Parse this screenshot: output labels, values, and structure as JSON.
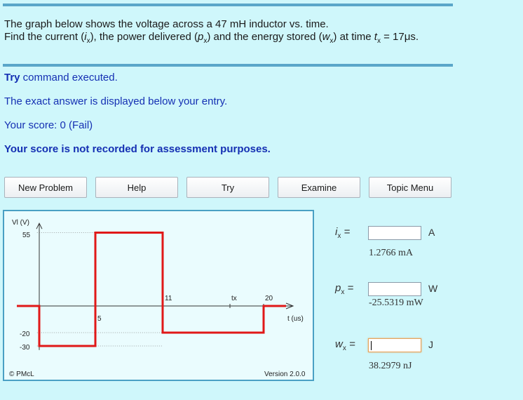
{
  "question": {
    "line1": "The graph below shows the voltage across a 47 mH inductor vs. time.",
    "line2_parts": [
      "Find the current (",
      "i",
      "x",
      "), the power delivered (",
      "p",
      "x",
      ") and the energy stored (",
      "w",
      "x",
      ") at time ",
      "t",
      "x",
      " = 17μs."
    ]
  },
  "messages": {
    "try_bold": "Try",
    "try_rest": " command executed.",
    "exact": "The exact answer is displayed below your entry.",
    "score": "Your score: 0 (Fail)",
    "not_recorded": "Your score is not recorded for assessment purposes."
  },
  "buttons": [
    "New Problem",
    "Help",
    "Try",
    "Examine",
    "Topic Menu"
  ],
  "graph": {
    "y_axis_label": "Vl (V)",
    "x_axis_label": "t (us)",
    "y_ticks": [
      "55",
      "-20",
      "-30"
    ],
    "x_ticks": [
      "5",
      "11",
      "tx",
      "20"
    ],
    "copyright": "© PMcL",
    "version": "Version 2.0.0"
  },
  "chart_data": {
    "type": "line",
    "title": "",
    "xlabel": "t (us)",
    "ylabel": "Vl (V)",
    "x": [
      -2,
      0,
      0,
      5,
      5,
      11,
      11,
      20,
      20,
      22
    ],
    "y": [
      0,
      0,
      -30,
      -30,
      55,
      55,
      -20,
      -20,
      0,
      0
    ],
    "marked_x": 17,
    "marked_x_label": "tx",
    "xlim": [
      -2,
      22
    ],
    "ylim": [
      -35,
      62
    ],
    "color": "#e01818"
  },
  "answers": [
    {
      "symbol": "i",
      "sub": "x",
      "unit": "A",
      "value": "",
      "exact": "1.2766 mA"
    },
    {
      "symbol": "p",
      "sub": "x",
      "unit": "W",
      "value": "",
      "exact": "-25.5319 mW"
    },
    {
      "symbol": "w",
      "sub": "x",
      "unit": "J",
      "value": "",
      "exact": "38.2979 nJ"
    }
  ],
  "colors": {
    "accent_rule": "#5aa6c9",
    "message_blue": "#1530b3",
    "waveform": "#e01818"
  }
}
